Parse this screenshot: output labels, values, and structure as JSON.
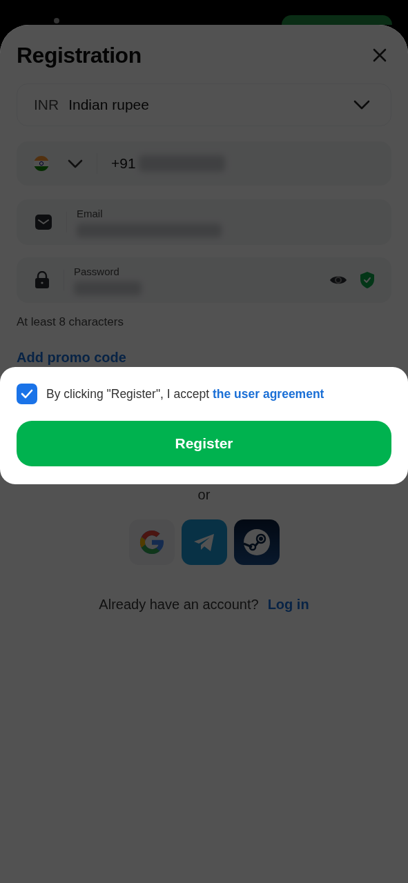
{
  "title": "Registration",
  "currency": {
    "code": "INR",
    "name": "Indian rupee"
  },
  "phone": {
    "prefix": "+91"
  },
  "email": {
    "label": "Email"
  },
  "password": {
    "label": "Password",
    "hint": "At least 8 characters"
  },
  "promo_link": "Add promo code",
  "agreement": {
    "checked": true,
    "text": "By clicking \"Register\", I accept",
    "link": "the user agreement"
  },
  "register_button": "Register",
  "divider": "or",
  "login": {
    "question": "Already have an account?",
    "link": "Log in"
  }
}
